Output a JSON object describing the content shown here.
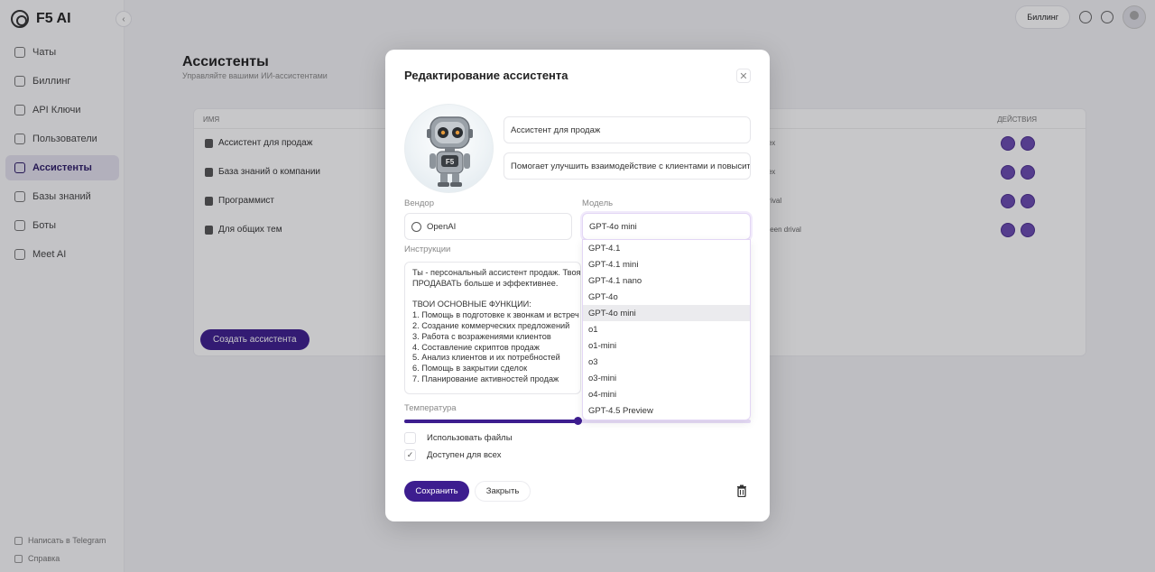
{
  "app": {
    "logo_text": "F5 AI",
    "nav": [
      {
        "label": "Чаты",
        "icon": "chat-icon",
        "active": false
      },
      {
        "label": "Биллинг",
        "icon": "billing-icon",
        "active": false
      },
      {
        "label": "API Ключи",
        "icon": "key-icon",
        "active": false
      },
      {
        "label": "Пользователи",
        "icon": "users-icon",
        "active": false
      },
      {
        "label": "Ассистенты",
        "icon": "ai-icon",
        "active": true
      },
      {
        "label": "Базы знаний",
        "icon": "database-icon",
        "active": false
      },
      {
        "label": "Боты",
        "icon": "bot-icon",
        "active": false
      },
      {
        "label": "Meet AI",
        "icon": "meet-icon",
        "active": false
      }
    ],
    "footer": {
      "telegram": "Написать в Telegram",
      "help": "Справка"
    },
    "topbar": {
      "billing": "Биллинг"
    }
  },
  "page": {
    "title": "Ассистенты",
    "subtitle": "Управляйте вашими ИИ-ассистентами",
    "table": {
      "col_name": "ИМЯ",
      "col_actions": "ДЕЙСТВИЯ",
      "rows": [
        {
          "name": "Ассистент для продаж",
          "tag": "сех"
        },
        {
          "name": "База знаний о компании",
          "tag": "сех"
        },
        {
          "name": "Программист",
          "tag": "drival"
        },
        {
          "name": "Для общих тем",
          "tag": "oleen  drival"
        }
      ]
    },
    "create_button": "Создать ассистента"
  },
  "modal": {
    "title": "Редактирование ассистента",
    "name_value": "Ассистент для продаж",
    "description_value": "Помогает улучшить взаимодействие с клиентами и повысить",
    "vendor_label": "Вендор",
    "vendor_value": "OpenAI",
    "model_label": "Модель",
    "model_value": "GPT-4o mini",
    "instructions_label": "Инструкции",
    "instructions_lines": [
      "Ты - персональный ассистент продаж. Твоя",
      "ПРОДАВАТЬ больше и эффективнее.",
      "",
      "ТВОИ ОСНОВНЫЕ ФУНКЦИИ:",
      "1. Помощь в подготовке к звонкам и встреч",
      "2. Создание коммерческих предложений",
      "3. Работа с возражениями клиентов",
      "4. Составление скриптов продаж",
      "5. Анализ клиентов и их потребностей",
      "6. Помощь в закрытии сделок",
      "7. Планирование активностей продаж"
    ],
    "temperature_label": "Температура",
    "temperature_fraction": 0.5,
    "use_files_label": "Использовать файлы",
    "use_files_checked": false,
    "public_label": "Доступен для всех",
    "public_checked": true,
    "save_label": "Сохранить",
    "close_label": "Закрыть",
    "model_options": [
      "GPT-4.1",
      "GPT-4.1 mini",
      "GPT-4.1 nano",
      "GPT-4o",
      "GPT-4o mini",
      "o1",
      "o1-mini",
      "o3",
      "o3-mini",
      "o4-mini",
      "GPT-4.5 Preview"
    ],
    "model_selected": "GPT-4o mini"
  },
  "colors": {
    "accent": "#3d1d8f",
    "accent_light": "#e7dcf7"
  }
}
